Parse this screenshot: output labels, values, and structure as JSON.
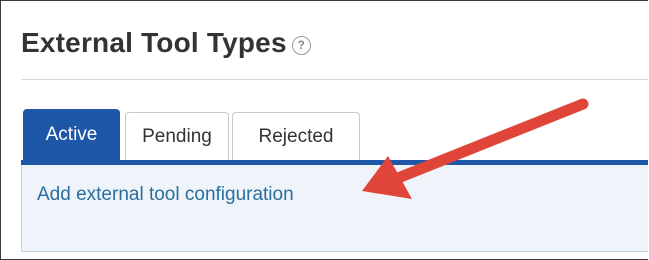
{
  "header": {
    "title": "External Tool Types",
    "help_icon": "question-mark-circle-icon"
  },
  "tabs": [
    {
      "label": "Active",
      "active": true
    },
    {
      "label": "Pending",
      "active": false
    },
    {
      "label": "Rejected",
      "active": false
    }
  ],
  "panel": {
    "link_text": "Add external tool configuration"
  },
  "annotation": {
    "arrow_color": "#e0453a"
  },
  "colors": {
    "accent": "#1f57a8",
    "link": "#2a6e9e",
    "panel_bg": "#eef4f9"
  }
}
